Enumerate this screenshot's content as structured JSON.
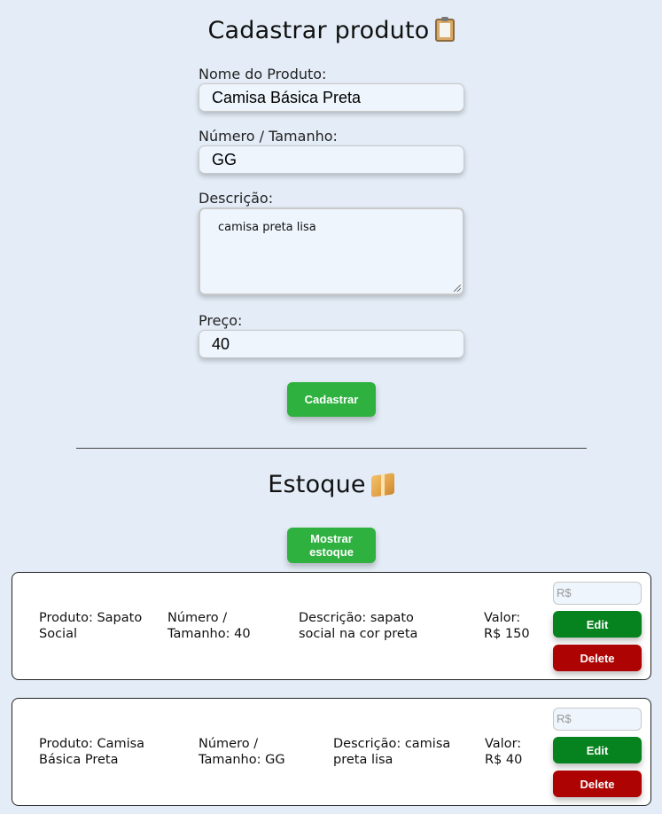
{
  "form": {
    "title": "Cadastrar produto",
    "title_icon": "clipboard-icon",
    "name_label": "Nome do Produto:",
    "name_value": "Camisa Básica Preta",
    "size_label": "Número / Tamanho:",
    "size_value": "GG",
    "description_label": "Descrição:",
    "description_value": "camisa preta lisa",
    "price_label": "Preço:",
    "price_value": "40",
    "submit_label": "Cadastrar"
  },
  "stock": {
    "title": "Estoque",
    "title_icon": "package-icon",
    "show_label": "Mostrar estoque",
    "items": [
      {
        "product": "Produto: Sapato Social",
        "size": "Número / Tamanho: 40",
        "description": "Descrição: sapato social na cor preta",
        "value": "Valor: R$ 150",
        "price_placeholder": "R$",
        "edit_label": "Edit",
        "delete_label": "Delete"
      },
      {
        "product": "Produto: Camisa Básica Preta",
        "size": "Número / Tamanho: GG",
        "description": "Descrição: camisa preta lisa",
        "value": "Valor: R$ 40",
        "price_placeholder": "R$",
        "edit_label": "Edit",
        "delete_label": "Delete"
      }
    ]
  },
  "colors": {
    "background": "#e4edf7",
    "primary_green": "#2fb13f",
    "edit_green": "#06821e",
    "delete_red": "#ad0303"
  }
}
